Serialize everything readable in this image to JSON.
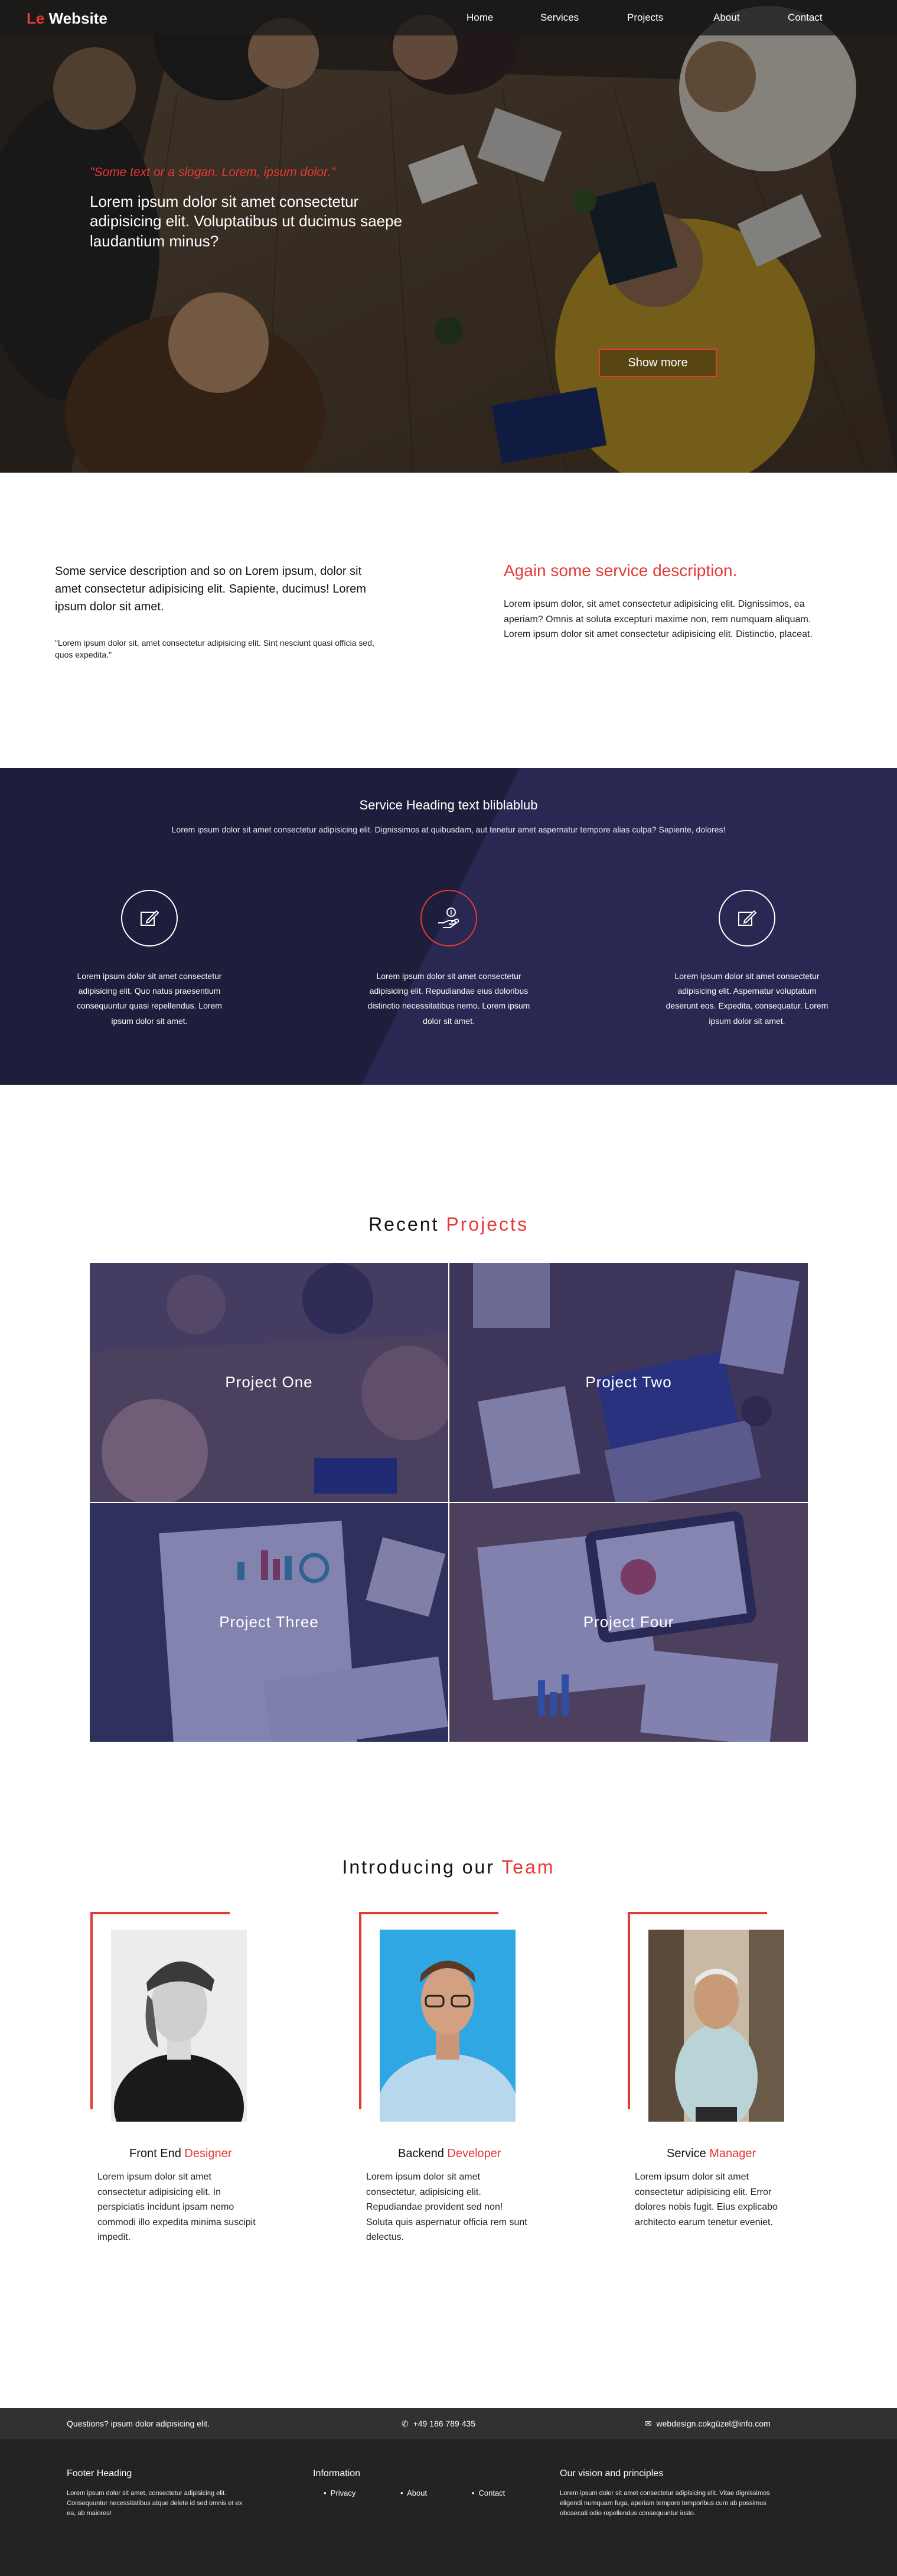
{
  "nav": {
    "logo_accent": "Le",
    "logo_text": "Website",
    "items": [
      "Home",
      "Services",
      "Projects",
      "About",
      "Contact"
    ]
  },
  "hero": {
    "kicker": "\"Some text or a slogan. Lorem, ipsum dolor.\"",
    "title": "Lorem ipsum dolor sit amet consectetur adipisicing elit. Voluptatibus ut ducimus saepe laudantium minus?",
    "button_label": "Show more"
  },
  "description": {
    "left_main": "Some service description and so on Lorem ipsum, dolor sit amet consectetur adipisicing elit. Sapiente, ducimus! Lorem ipsum dolor sit amet.",
    "left_quote": "\"Lorem ipsum dolor sit, amet consectetur adipisicing elit. Sint nesciunt quasi officia sed, quos expedita.\"",
    "right_title": "Again some service description.",
    "right_text": "Lorem ipsum dolor, sit amet consectetur adipisicing elit. Dignissimos, ea aperiam? Omnis at soluta excepturi maxime non, rem numquam aliquam. Lorem ipsum dolor sit amet consectetur adipisicing elit. Distinctio, placeat."
  },
  "services": {
    "heading": "Service Heading text bliblablub",
    "subheading": "Lorem ipsum dolor sit amet consectetur adipisicing elit. Dignissimos at quibusdam, aut tenetur amet aspernatur tempore alias culpa? Sapiente, dolores!",
    "cards": [
      {
        "icon": "edit-icon",
        "text": "Lorem ipsum dolor sit amet consectetur adipisicing elit. Quo natus praesentium consequuntur quasi repellendus. Lorem ipsum dolor sit amet."
      },
      {
        "icon": "hand-coin-icon",
        "text": "Lorem ipsum dolor sit amet consectetur adipisicing elit. Repudiandae eius doloribus distinctio necessitatibus nemo. Lorem ipsum dolor sit amet."
      },
      {
        "icon": "edit-icon",
        "text": "Lorem ipsum dolor sit amet consectetur adipisicing elit. Aspernatur voluptatum deserunt eos. Expedita, consequatur. Lorem ipsum dolor sit amet."
      }
    ],
    "colors": {
      "dark": "#1d1d3c",
      "purple": "#292852",
      "accent": "#e53935"
    }
  },
  "projects": {
    "title_plain": "Recent",
    "title_accent": "Projects",
    "items": [
      "Project One",
      "Project Two",
      "Project Three",
      "Project Four"
    ]
  },
  "team": {
    "title_plain": "Introducing our",
    "title_accent": "Team",
    "members": [
      {
        "role_plain": "Front End",
        "role_accent": "Designer",
        "bio": "Lorem ipsum dolor sit amet consectetur adipisicing elit. In perspiciatis incidunt ipsam nemo commodi illo expedita minima suscipit impedit."
      },
      {
        "role_plain": "Backend",
        "role_accent": "Developer",
        "bio": "Lorem ipsum dolor sit amet consectetur, adipisicing elit. Repudiandae provident sed non! Soluta quis aspernatur officia rem sunt delectus."
      },
      {
        "role_plain": "Service",
        "role_accent": "Manager",
        "bio": "Lorem ipsum dolor sit amet consectetur adipisicing elit. Error dolores nobis fugit. Eius explicabo architecto earum tenetur eveniet."
      }
    ]
  },
  "footer": {
    "question": "Questions? ipsum dolor adipisicing elit.",
    "phone": "+49 186 789 435",
    "email": "webdesign.cokgüzel@info.com",
    "col1_title": "Footer Heading",
    "col1_text": "Lorem ipsum dolor sit amet, consectetur adipisicing elit. Consequuntur necessitatibus atque delete id sed omnis et ex ea, ab maiores!",
    "col2_title": "Information",
    "links": [
      "Privacy",
      "About",
      "Contact"
    ],
    "col3_title": "Our vision and principles",
    "col3_text": "Lorem ipsum dolor sit amet consectetur adipisicing elit. Vitae dignissimos eligendi numquam fuga, aperiam tempore temporibus cum ab possimus obcaecati odio repellendus consequuntur iusto."
  }
}
